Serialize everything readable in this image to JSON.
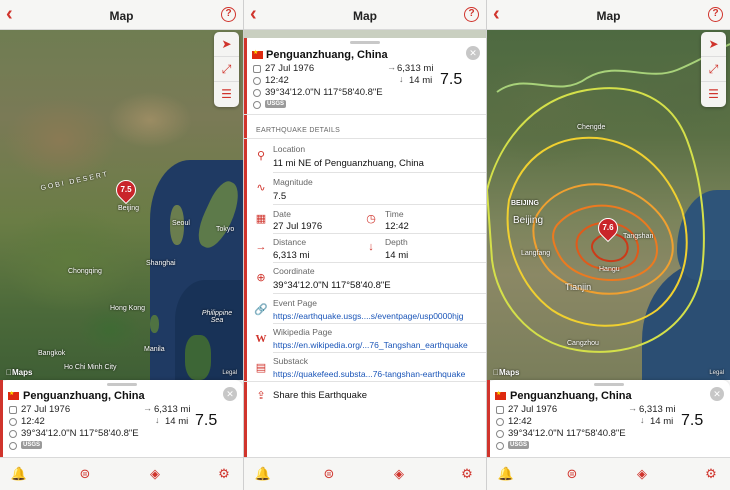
{
  "colors": {
    "accent": "#d0342c",
    "link": "#1a55b8",
    "pin": "#c9242a"
  },
  "nav": {
    "title": "Map",
    "back_icon": "chevron-left-icon",
    "help_icon": "question-circle-icon"
  },
  "map_controls": [
    "location-arrow-icon",
    "expand-arrows-icon",
    "list-icon"
  ],
  "map1": {
    "labels": [
      "GOBI DESERT",
      "Beijing",
      "Seoul",
      "Tokyo",
      "Shanghai",
      "Chongqing",
      "Hong Kong",
      "Philippine Sea",
      "Manila",
      "Bangkok",
      "Ho Chi Minh City"
    ],
    "pin_value": "7.5",
    "apple_maps": "Maps",
    "legal": "Legal"
  },
  "map3": {
    "labels": [
      "Chengde",
      "BEIJING",
      "Beijing",
      "Langfang",
      "Tangshan",
      "Hangu",
      "Tianjin",
      "Cangzhou"
    ],
    "pin_value": "7.6",
    "apple_maps": "Maps",
    "legal": "Legal"
  },
  "card": {
    "place": "Penguanzhuang, China",
    "date": "27 Jul 1976",
    "time": "12:42",
    "coordinate": "39°34'12.0\"N 117°58'40.8\"E",
    "source": "USGS",
    "distance": "6,313 mi",
    "depth": "14 mi",
    "magnitude": "7.5",
    "distance_arrow": "→",
    "depth_arrow": "↓",
    "close": "✕"
  },
  "details": {
    "section_title": "EARTHQUAKE DETAILS",
    "location_label": "Location",
    "location_value": "11 mi NE of Penguanzhuang, China",
    "magnitude_label": "Magnitude",
    "magnitude_value": "7.5",
    "date_label": "Date",
    "date_value": "27 Jul 1976",
    "time_label": "Time",
    "time_value": "12:42",
    "distance_label": "Distance",
    "distance_value": "6,313 mi",
    "depth_label": "Depth",
    "depth_value": "14 mi",
    "coordinate_label": "Coordinate",
    "coordinate_value": "39°34'12.0\"N 117°58'40.8\"E",
    "event_page_label": "Event Page",
    "event_page_link": "https://earthquake.usgs....s/eventpage/usp0000hjg",
    "wikipedia_label": "Wikipedia Page",
    "wikipedia_link": "https://en.wikipedia.org/...76_Tangshan_earthquake",
    "substack_label": "Substack",
    "substack_link": "https://quakefeed.substa...76-tangshan-earthquake",
    "share_label": "Share this Earthquake"
  },
  "tabs": [
    "bell-icon",
    "list-circle-icon",
    "layers-icon",
    "gear-icon"
  ]
}
